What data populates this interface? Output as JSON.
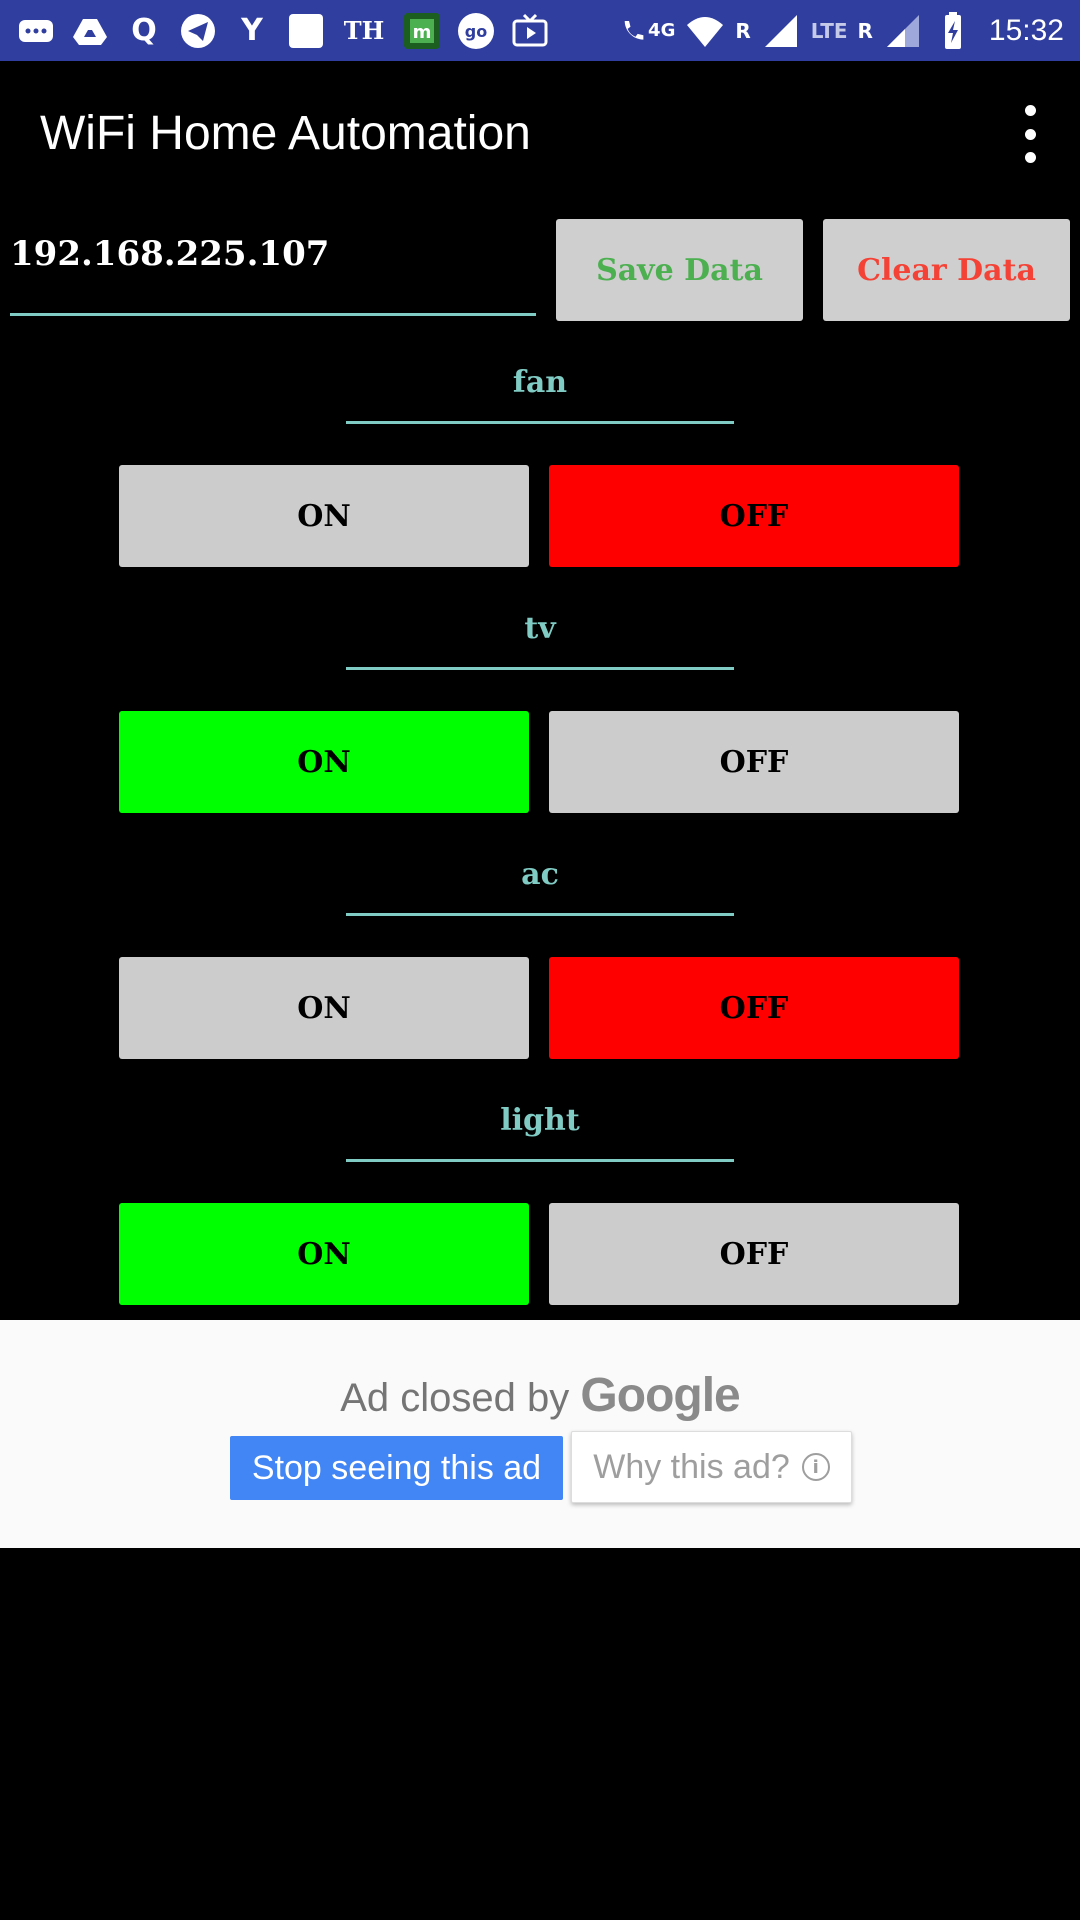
{
  "status_bar": {
    "time": "15:32",
    "indicators": {
      "four_g": "4G",
      "r1": "R",
      "lte": "LTE",
      "r2": "R",
      "th": "TH"
    },
    "left_icons": [
      "chat-icon",
      "drive-icon",
      "quora-icon",
      "telegram-icon",
      "yandex-icon",
      "blank-app-icon",
      "th-icon",
      "m-app-icon",
      "go-app-icon",
      "tv-icon"
    ],
    "right_icons": [
      "call-wifi-icon",
      "wifi-icon",
      "signal-icon",
      "lte-signal-icon",
      "battery-charging-icon"
    ]
  },
  "app_bar": {
    "title": "WiFi Home Automation"
  },
  "ip_row": {
    "ip_value": "192.168.225.107",
    "save_label": "Save Data",
    "clear_label": "Clear Data",
    "save_color": "#4caf50",
    "clear_color": "#f44336"
  },
  "devices": [
    {
      "name": "fan",
      "on_label": "ON",
      "off_label": "OFF",
      "active": "off"
    },
    {
      "name": "tv",
      "on_label": "ON",
      "off_label": "OFF",
      "active": "on"
    },
    {
      "name": "ac",
      "on_label": "ON",
      "off_label": "OFF",
      "active": "off"
    },
    {
      "name": "light",
      "on_label": "ON",
      "off_label": "OFF",
      "active": "on"
    }
  ],
  "colors": {
    "on_active": "#00ff00",
    "off_active": "#ff0000",
    "inactive": "#cccccc",
    "accent": "#80cbc4",
    "status_bar": "#303f9f"
  },
  "ad": {
    "closed_text": "Ad closed by",
    "brand": "Google",
    "stop_label": "Stop seeing this ad",
    "why_label": "Why this ad?"
  }
}
